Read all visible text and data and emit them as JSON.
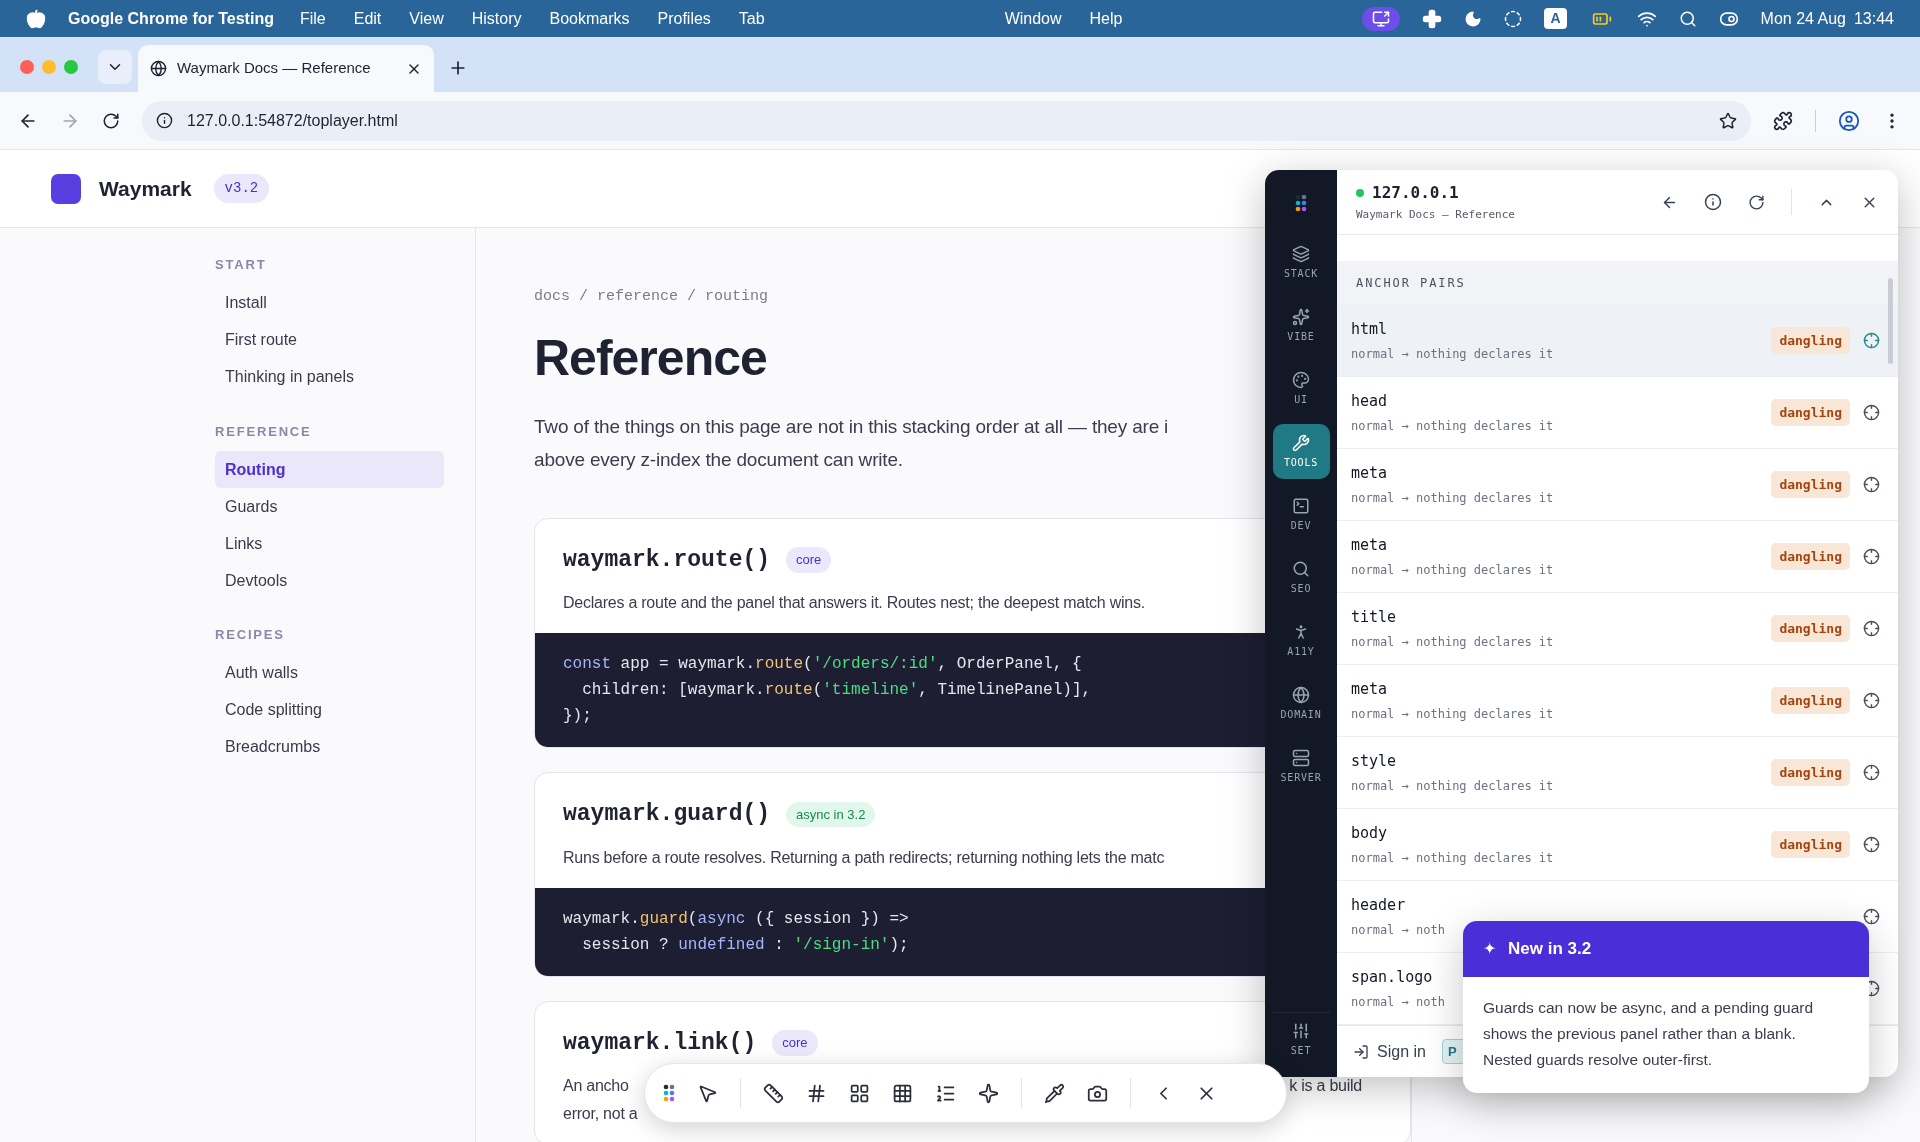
{
  "menubar": {
    "app": "Google Chrome for Testing",
    "menus": [
      "File",
      "Edit",
      "View",
      "History",
      "Bookmarks",
      "Profiles",
      "Tab"
    ],
    "menus_right": [
      "Window",
      "Help"
    ],
    "input_source": "A",
    "date": "Mon 24 Aug",
    "time": "13:44"
  },
  "browser": {
    "tab_title": "Waymark Docs — Reference",
    "url": "127.0.0.1:54872/toplayer.html",
    "forward_disabled": true
  },
  "site": {
    "name": "Waymark",
    "version": "v3.2"
  },
  "sidebar": [
    {
      "heading": "START",
      "items": [
        {
          "label": "Install",
          "selected": false
        },
        {
          "label": "First route",
          "selected": false
        },
        {
          "label": "Thinking in panels",
          "selected": false
        }
      ]
    },
    {
      "heading": "REFERENCE",
      "items": [
        {
          "label": "Routing",
          "selected": true
        },
        {
          "label": "Guards",
          "selected": false
        },
        {
          "label": "Links",
          "selected": false
        },
        {
          "label": "Devtools",
          "selected": false
        }
      ]
    },
    {
      "heading": "RECIPES",
      "items": [
        {
          "label": "Auth walls",
          "selected": false
        },
        {
          "label": "Code splitting",
          "selected": false
        },
        {
          "label": "Breadcrumbs",
          "selected": false
        }
      ]
    }
  ],
  "breadcrumb": "docs / reference / routing",
  "title": "Reference",
  "intro": [
    "Two of the things on this page are not in this stacking order at all — they are i",
    "above every z-index the document can write."
  ],
  "cards": [
    {
      "name": "waymark.route()",
      "tag": {
        "text": "core",
        "kind": "core"
      },
      "description": [
        "Declares a route and the panel that answers it. Routes nest; the deepest match wins."
      ],
      "code": [
        [
          {
            "t": "const",
            "kind": "keyword"
          },
          {
            "t": " app = waymark.",
            "kind": "plain"
          },
          {
            "t": "route",
            "kind": "function"
          },
          {
            "t": "(",
            "kind": "plain"
          },
          {
            "t": "'/orders/:id'",
            "kind": "string"
          },
          {
            "t": ", OrderPanel, {",
            "kind": "plain"
          }
        ],
        [
          {
            "t": "  children: [waymark.",
            "kind": "plain"
          },
          {
            "t": "route",
            "kind": "function"
          },
          {
            "t": "(",
            "kind": "plain"
          },
          {
            "t": "'timeline'",
            "kind": "string"
          },
          {
            "t": ", TimelinePanel)],",
            "kind": "plain"
          }
        ],
        [
          {
            "t": "});",
            "kind": "plain"
          }
        ]
      ]
    },
    {
      "name": "waymark.guard()",
      "tag": {
        "text": "async in 3.2",
        "kind": "new"
      },
      "description": [
        "Runs before a route resolves. Returning a path redirects; returning nothing lets the matc"
      ],
      "code": [
        [
          {
            "t": "waymark.",
            "kind": "plain"
          },
          {
            "t": "guard",
            "kind": "function"
          },
          {
            "t": "(",
            "kind": "plain"
          },
          {
            "t": "async",
            "kind": "keyword"
          },
          {
            "t": " ({ session }) =>",
            "kind": "plain"
          }
        ],
        [
          {
            "t": "  session ? ",
            "kind": "plain"
          },
          {
            "t": "undefined",
            "kind": "keyword"
          },
          {
            "t": " : ",
            "kind": "plain"
          },
          {
            "t": "'/sign-in'",
            "kind": "string"
          },
          {
            "t": ");",
            "kind": "plain"
          }
        ]
      ]
    },
    {
      "name": "waymark.link()",
      "tag": {
        "text": "core",
        "kind": "core"
      },
      "description": [
        "An ancho",
        "error, not a"
      ],
      "description_tail": "k is a build"
    }
  ],
  "devtools": {
    "host": "127.0.0.1",
    "connected": true,
    "page": "Waymark Docs — Reference",
    "rail": [
      {
        "label": "STACK",
        "selected": false
      },
      {
        "label": "VIBE",
        "selected": false
      },
      {
        "label": "UI",
        "selected": false
      },
      {
        "label": "TOOLS",
        "selected": true
      },
      {
        "label": "DEV",
        "selected": false
      },
      {
        "label": "SEO",
        "selected": false
      },
      {
        "label": "A11Y",
        "selected": false
      },
      {
        "label": "DOMAIN",
        "selected": false
      },
      {
        "label": "SERVER",
        "selected": false
      }
    ],
    "rail_bottom": "SET",
    "section": "ANCHOR PAIRS",
    "rows": [
      {
        "name": "html",
        "detail": "normal → nothing declares it",
        "badge": "dangling",
        "selected": true
      },
      {
        "name": "head",
        "detail": "normal → nothing declares it",
        "badge": "dangling",
        "selected": false
      },
      {
        "name": "meta",
        "detail": "normal → nothing declares it",
        "badge": "dangling",
        "selected": false
      },
      {
        "name": "meta",
        "detail": "normal → nothing declares it",
        "badge": "dangling",
        "selected": false
      },
      {
        "name": "title",
        "detail": "normal → nothing declares it",
        "badge": "dangling",
        "selected": false
      },
      {
        "name": "meta",
        "detail": "normal → nothing declares it",
        "badge": "dangling",
        "selected": false
      },
      {
        "name": "style",
        "detail": "normal → nothing declares it",
        "badge": "dangling",
        "selected": false
      },
      {
        "name": "body",
        "detail": "normal → nothing declares it",
        "badge": "dangling",
        "selected": false
      },
      {
        "name": "header",
        "detail": "normal → noth",
        "selected": false
      },
      {
        "name": "span.logo",
        "detail": "normal → noth",
        "selected": false
      }
    ],
    "sign_in": "Sign in",
    "chip": "P"
  },
  "popup": {
    "icon": "✦",
    "title": "New in 3.2",
    "body": "Guards can now be async, and a pending guard shows the previous panel rather than a blank. Nested guards resolve outer-first."
  }
}
